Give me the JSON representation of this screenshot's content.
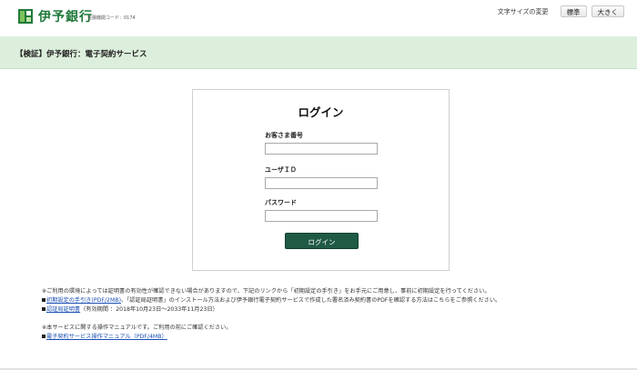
{
  "header": {
    "bank_name": "伊予銀行",
    "bank_code": "金融機関コード：0174",
    "font_size_label": "文字サイズの変更",
    "font_standard": "標準",
    "font_large": "大きく"
  },
  "titlebar": {
    "title": "【検証】伊予銀行：電子契約サービス"
  },
  "login": {
    "title": "ログイン",
    "customer_number_label": "お客さま番号",
    "user_id_label": "ユーザＩＤ",
    "password_label": "パスワード",
    "customer_number_value": "",
    "user_id_value": "",
    "password_value": "",
    "button_label": "ログイン"
  },
  "notes": {
    "line1": "※ご利用の環境によっては証明書の有効性が確認できない場合がありますので、下記のリンクから「初期設定の手引き」をお手元にご用意し、事前に初期設定を行ってください。",
    "line2_link": "初期設定の手引き(PDF/2MB)",
    "line2_text": "、「認証局証明書」のインストール方法および伊予銀行電子契約サービスで作成した署名済み契約書のPDFを確認する方法はこちらをご参照ください。",
    "line3_link": "認証局証明書",
    "line3_text": "（有効期間 ：2018年10月23日～2033年11月23日）",
    "line4": "※本サービスに関する操作マニュアルです。ご利用の前にご確認ください。",
    "line5_link": "電子契約サービス操作マニュアル（PDF/4MB）"
  },
  "colors": {
    "brand_green": "#1f7a3a",
    "titlebar_bg": "#dcefdc",
    "login_button": "#1f5a45",
    "link": "#1a4fb4"
  }
}
